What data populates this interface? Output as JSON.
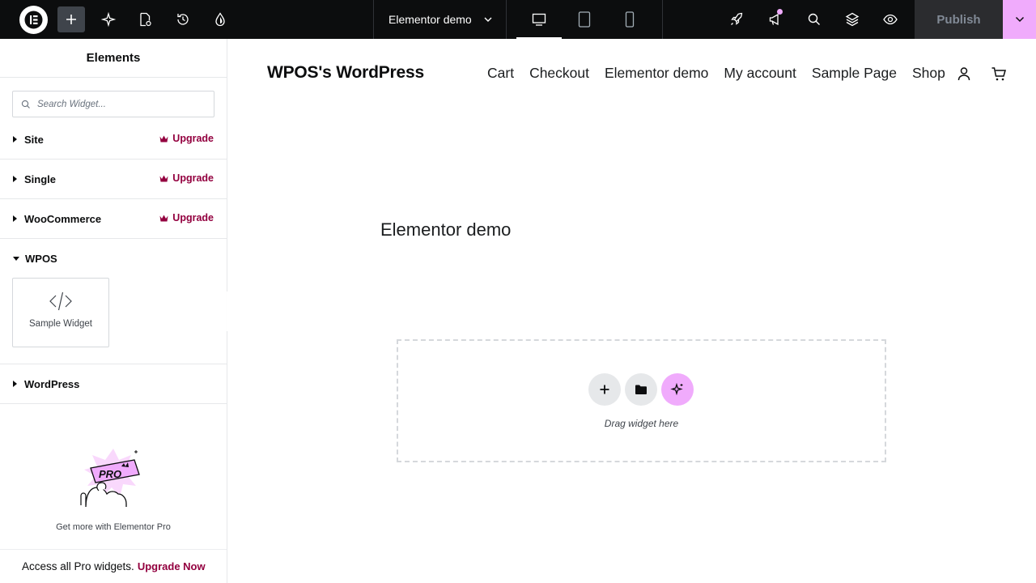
{
  "topbar": {
    "document_title": "Elementor demo",
    "publish_label": "Publish"
  },
  "panel": {
    "title": "Elements",
    "search_placeholder": "Search Widget...",
    "categories": [
      {
        "label": "Site",
        "upgrade": "Upgrade"
      },
      {
        "label": "Single",
        "upgrade": "Upgrade"
      },
      {
        "label": "WooCommerce",
        "upgrade": "Upgrade"
      },
      {
        "label": "WPOS"
      },
      {
        "label": "WordPress"
      }
    ],
    "widget": {
      "label": "Sample Widget"
    },
    "promo": {
      "image_text": "PRO",
      "text": "Get more with Elementor Pro",
      "bar_text": "Access all Pro widgets.",
      "bar_link": "Upgrade Now"
    }
  },
  "site": {
    "title": "WPOS's WordPress",
    "nav": [
      "Cart",
      "Checkout",
      "Elementor demo",
      "My account",
      "Sample Page",
      "Shop"
    ]
  },
  "page": {
    "heading": "Elementor demo",
    "drop_label": "Drag widget here"
  },
  "colors": {
    "accent_pink": "#f0abfc",
    "upgrade_red": "#93003f",
    "topbar_bg": "#0c0d0e"
  }
}
